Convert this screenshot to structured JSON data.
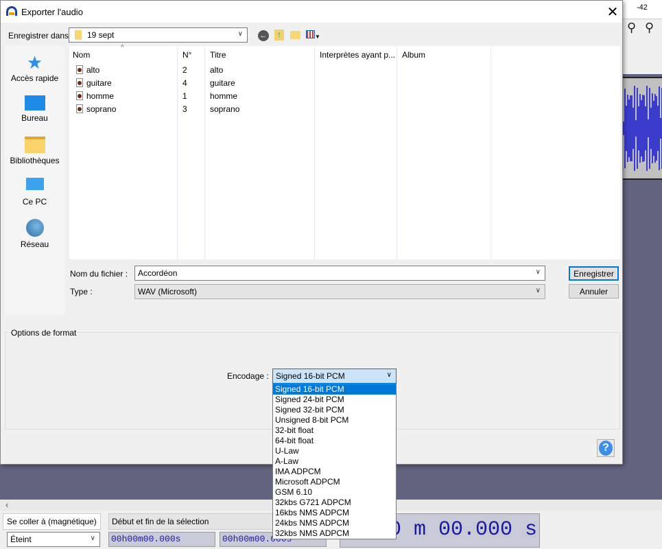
{
  "app": {
    "ruler_label": "-42",
    "snap_label": "Se coller à (magnétique)",
    "snap_value": "Éteint",
    "selection_label": "Début et fin de la sélection",
    "time_start": "00h00m00.000s",
    "time_end": "00h00m00.000s",
    "big_time": "00 m 00.000 s",
    "scroll_left": "‹"
  },
  "dialog": {
    "title": "Exporter l'audio",
    "save_in_label": "Enregistrer dans :",
    "save_in_value": "19 sept",
    "sidebar": [
      {
        "label": "Accès rapide",
        "icon": "star-icon"
      },
      {
        "label": "Bureau",
        "icon": "desktop-icon"
      },
      {
        "label": "Bibliothèques",
        "icon": "libraries-icon"
      },
      {
        "label": "Ce PC",
        "icon": "computer-icon"
      },
      {
        "label": "Réseau",
        "icon": "network-icon"
      }
    ],
    "columns": [
      "Nom",
      "N°",
      "Titre",
      "Interprètes ayant p...",
      "Album"
    ],
    "files": [
      {
        "name": "alto",
        "num": "2",
        "title": "alto"
      },
      {
        "name": "guitare",
        "num": "4",
        "title": "guitare"
      },
      {
        "name": "homme",
        "num": "1",
        "title": "homme"
      },
      {
        "name": "soprano",
        "num": "3",
        "title": "soprano"
      }
    ],
    "filename_label": "Nom du fichier :",
    "filename_value": "Accordéon",
    "type_label": "Type :",
    "type_value": "WAV (Microsoft)",
    "save_button": "Enregistrer",
    "cancel_button": "Annuler",
    "options_label": "Options de format",
    "encoding_label": "Encodage :",
    "encoding_value": "Signed 16-bit PCM",
    "encoding_options": [
      "Signed 16-bit PCM",
      "Signed 24-bit PCM",
      "Signed 32-bit PCM",
      "Unsigned 8-bit PCM",
      "32-bit float",
      "64-bit float",
      "U-Law",
      "A-Law",
      "IMA ADPCM",
      "Microsoft ADPCM",
      "GSM 6.10",
      "32kbs G721 ADPCM",
      "16kbs NMS ADPCM",
      "24kbs NMS ADPCM",
      "32kbs NMS ADPCM"
    ],
    "help_label": "?"
  },
  "colors": {
    "accent": "#0078d7",
    "app_bg": "#62647f",
    "waveform": "#3b3bcc"
  }
}
